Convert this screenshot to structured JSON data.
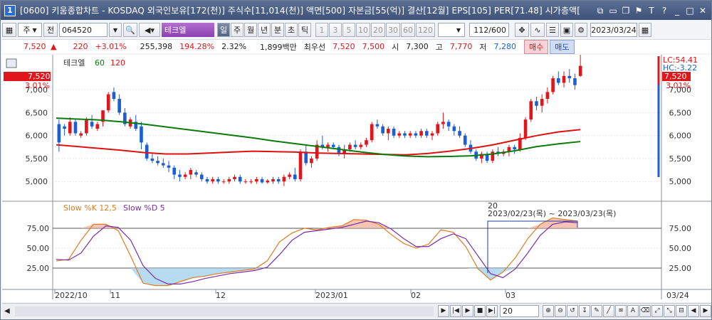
{
  "window": {
    "number": "1",
    "title": "[0600] 키움종합차트 - KOSDAQ 외국인보유[172(천)] 주식수[11,014(천)] 액면[500] 자본금[55(억)] 결산[12월] EPS[105] PER[71.48] 시가총액["
  },
  "toolbar": {
    "market_type": "주",
    "prev_label": "전",
    "stock_code": "064520",
    "stock_name": "테크엘",
    "periods": [
      "일",
      "주",
      "월",
      "년",
      "분",
      "초",
      "틱"
    ],
    "active_period": "일",
    "minute_options": [
      "1",
      "3",
      "5",
      "10",
      "20",
      "30",
      "60",
      "120"
    ],
    "count_display": "112/600",
    "date": "2023/03/24"
  },
  "quote": {
    "price": "7,520",
    "change_arrow": "▲",
    "change": "220",
    "change_pct": "+3.01%",
    "volume": "255,398",
    "volume_ratio": "194.28%",
    "turnover": "2.32%",
    "amount": "1,899백만",
    "best_label": "최우선",
    "ask": "7,520",
    "bid": "7,500",
    "open_label": "시",
    "open": "7,300",
    "high_label": "고",
    "high": "7,770",
    "low_label": "저",
    "low": "7,280",
    "buy_label": "매수",
    "sell_label": "매도"
  },
  "price_panel": {
    "legend_name": "테크엘",
    "ma_short": "60",
    "ma_long": "120",
    "current_price": "7,520",
    "current_pct": "3.01%",
    "lc_label": "LC:54.41",
    "hc_label": "HC:-3.22",
    "y_ticks": [
      "7,000",
      "6,500",
      "6,000",
      "5,500",
      "5,000"
    ],
    "colors": {
      "up": "#e0161b",
      "down": "#1a5fd6",
      "ma60": "#0a7a0a",
      "ma120": "#e01010"
    }
  },
  "stoch_panel": {
    "k_label": "Slow %K 12,5",
    "d_label": "Slow %D 5",
    "y_ticks": [
      "75.00",
      "50.00",
      "25.00"
    ],
    "annotation_days": "20",
    "annotation_range": "2023/02/23(목) ~ 2023/03/23(목)",
    "colors": {
      "k": "#e07a20",
      "d": "#7a2aa8"
    }
  },
  "x_axis": {
    "labels": [
      "2022/10",
      "11",
      "12",
      "2023/01",
      "02",
      "03"
    ],
    "right_label": "03/24"
  },
  "chart_data": {
    "type": "candlestick",
    "title": "테크엘",
    "ylabel": "",
    "ylim": [
      4600,
      7700
    ],
    "candles": [
      [
        6250,
        6350,
        5650,
        5850
      ],
      [
        6200,
        6250,
        6000,
        6150
      ],
      [
        6050,
        6400,
        6000,
        6300
      ],
      [
        6300,
        6350,
        6000,
        6050
      ],
      [
        6000,
        6100,
        5950,
        6050
      ],
      [
        6050,
        6400,
        6000,
        6350
      ],
      [
        6300,
        6450,
        6150,
        6200
      ],
      [
        6150,
        6300,
        6100,
        6250
      ],
      [
        6300,
        6550,
        6200,
        6550
      ],
      [
        6550,
        6950,
        6500,
        6900
      ],
      [
        6950,
        7050,
        6750,
        6800
      ],
      [
        6800,
        6900,
        6450,
        6500
      ],
      [
        6500,
        6600,
        6200,
        6250
      ],
      [
        6200,
        6400,
        6150,
        6350
      ],
      [
        6300,
        6450,
        6100,
        6150
      ],
      [
        6200,
        6300,
        5700,
        5850
      ],
      [
        5800,
        5850,
        5450,
        5500
      ],
      [
        5500,
        5600,
        5400,
        5450
      ],
      [
        5450,
        5550,
        5350,
        5400
      ],
      [
        5400,
        5500,
        5300,
        5350
      ],
      [
        5350,
        5450,
        5200,
        5300
      ],
      [
        5300,
        5350,
        5050,
        5150
      ],
      [
        5150,
        5250,
        5000,
        5100
      ],
      [
        5100,
        5200,
        5050,
        5150
      ],
      [
        5150,
        5300,
        5050,
        5250
      ],
      [
        5200,
        5250,
        5100,
        5150
      ],
      [
        5150,
        5200,
        5000,
        5050
      ],
      [
        5050,
        5100,
        4950,
        5000
      ],
      [
        5000,
        5100,
        4950,
        5050
      ],
      [
        5050,
        5100,
        4950,
        5000
      ],
      [
        5000,
        5050,
        4950,
        5000
      ],
      [
        5000,
        5100,
        4950,
        5050
      ],
      [
        5050,
        5150,
        5000,
        5100
      ],
      [
        5100,
        5150,
        4950,
        5000
      ],
      [
        5000,
        5050,
        4950,
        5000
      ],
      [
        5000,
        5050,
        4950,
        5000
      ],
      [
        5000,
        5100,
        4950,
        5050
      ],
      [
        5050,
        5100,
        4950,
        4980
      ],
      [
        4980,
        5050,
        4950,
        5020
      ],
      [
        5000,
        5100,
        4950,
        5050
      ],
      [
        5050,
        5100,
        4950,
        5000
      ],
      [
        5000,
        5150,
        4900,
        5100
      ],
      [
        5100,
        5200,
        5050,
        5150
      ],
      [
        5150,
        5300,
        5000,
        5050
      ],
      [
        5050,
        5700,
        5000,
        5650
      ],
      [
        5650,
        5800,
        5350,
        5400
      ],
      [
        5400,
        5550,
        5300,
        5500
      ],
      [
        5500,
        5900,
        5450,
        5800
      ],
      [
        5800,
        6000,
        5700,
        5750
      ],
      [
        5750,
        5850,
        5650,
        5800
      ],
      [
        5800,
        5850,
        5700,
        5750
      ],
      [
        5750,
        5800,
        5550,
        5600
      ],
      [
        5600,
        5800,
        5500,
        5700
      ],
      [
        5700,
        5850,
        5650,
        5800
      ],
      [
        5800,
        5900,
        5700,
        5750
      ],
      [
        5750,
        5850,
        5700,
        5800
      ],
      [
        5800,
        5950,
        5750,
        5900
      ],
      [
        5900,
        6300,
        5850,
        6250
      ],
      [
        6250,
        6350,
        6150,
        6200
      ],
      [
        6200,
        6250,
        6000,
        6050
      ],
      [
        6050,
        6200,
        5900,
        6150
      ],
      [
        6150,
        6200,
        5950,
        6000
      ],
      [
        6000,
        6100,
        5950,
        6050
      ],
      [
        6050,
        6100,
        5950,
        6000
      ],
      [
        6000,
        6100,
        5950,
        6050
      ],
      [
        6050,
        6100,
        5950,
        6000
      ],
      [
        6000,
        6150,
        5950,
        6100
      ],
      [
        6100,
        6150,
        5950,
        6000
      ],
      [
        6000,
        6100,
        5900,
        6050
      ],
      [
        6050,
        6300,
        6000,
        6250
      ],
      [
        6250,
        6500,
        6150,
        6300
      ],
      [
        6300,
        6350,
        6100,
        6200
      ],
      [
        6200,
        6250,
        6000,
        6100
      ],
      [
        6100,
        6200,
        5950,
        6000
      ],
      [
        6000,
        6050,
        5750,
        5800
      ],
      [
        5800,
        5900,
        5600,
        5650
      ],
      [
        5650,
        5700,
        5450,
        5500
      ],
      [
        5500,
        5650,
        5400,
        5600
      ],
      [
        5600,
        5650,
        5400,
        5450
      ],
      [
        5450,
        5700,
        5400,
        5650
      ],
      [
        5650,
        5750,
        5550,
        5600
      ],
      [
        5600,
        5700,
        5550,
        5650
      ],
      [
        5650,
        5800,
        5550,
        5750
      ],
      [
        5750,
        5800,
        5600,
        5700
      ],
      [
        5700,
        6050,
        5650,
        5950
      ],
      [
        5950,
        6400,
        5900,
        6350
      ],
      [
        6350,
        6800,
        6300,
        6750
      ],
      [
        6750,
        6850,
        6550,
        6650
      ],
      [
        6650,
        6900,
        6500,
        6800
      ],
      [
        6800,
        7050,
        6700,
        6950
      ],
      [
        6950,
        7300,
        6900,
        7250
      ],
      [
        7250,
        7400,
        7100,
        7150
      ],
      [
        7150,
        7400,
        7050,
        7300
      ],
      [
        7300,
        7450,
        7150,
        7250
      ],
      [
        7250,
        7350,
        7000,
        7100
      ],
      [
        7300,
        7770,
        7280,
        7520
      ]
    ],
    "ma60": [
      6380,
      6360,
      6340,
      6300,
      6250,
      6190,
      6130,
      6070,
      6010,
      5950,
      5880,
      5820,
      5760,
      5700,
      5640,
      5590,
      5555,
      5540,
      5545,
      5560,
      5600,
      5670,
      5760,
      5820,
      5870
    ],
    "ma120": [
      5800,
      5760,
      5720,
      5680,
      5630,
      5600,
      5600,
      5620,
      5640,
      5660,
      5650,
      5640,
      5620,
      5610,
      5600,
      5590,
      5580,
      5610,
      5660,
      5720,
      5800,
      5900,
      6000,
      6080,
      6130
    ],
    "slow_k": [
      34,
      36,
      60,
      80,
      80,
      72,
      40,
      6,
      3,
      3,
      8,
      13,
      15,
      18,
      20,
      22,
      24,
      34,
      58,
      69,
      75,
      73,
      76,
      78,
      86,
      85,
      80,
      67,
      56,
      50,
      55,
      73,
      70,
      52,
      24,
      10,
      20,
      38,
      62,
      80,
      88,
      86,
      84
    ],
    "slow_d": [
      36,
      35,
      44,
      65,
      78,
      76,
      60,
      28,
      12,
      5,
      5,
      8,
      12,
      15,
      18,
      20,
      22,
      26,
      42,
      60,
      70,
      72,
      74,
      76,
      80,
      84,
      82,
      74,
      62,
      52,
      52,
      62,
      68,
      62,
      40,
      18,
      13,
      24,
      44,
      66,
      80,
      83,
      82
    ],
    "stoch_ylim": [
      0,
      100
    ]
  }
}
